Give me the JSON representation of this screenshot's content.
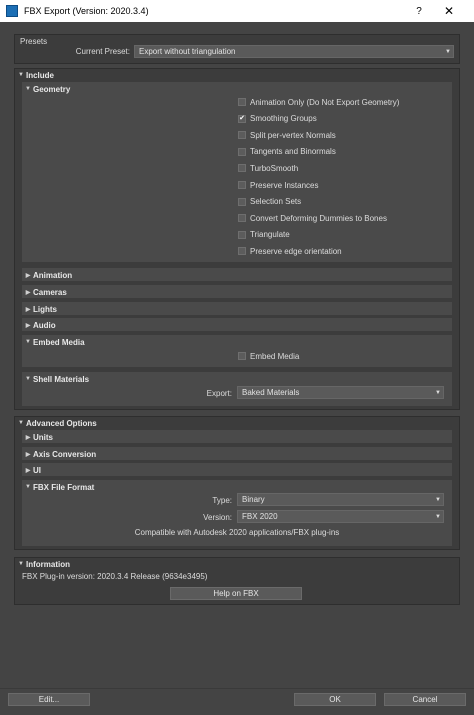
{
  "window": {
    "title": "FBX Export (Version: 2020.3.4)",
    "help": "?",
    "close": "✕"
  },
  "presets": {
    "section": "Presets",
    "current_label": "Current Preset:",
    "current_value": "Export without triangulation"
  },
  "include": {
    "title": "Include",
    "geometry": {
      "title": "Geometry",
      "options": [
        {
          "label": "Animation Only (Do Not Export Geometry)",
          "checked": false
        },
        {
          "label": "Smoothing Groups",
          "checked": true
        },
        {
          "label": "Split per-vertex Normals",
          "checked": false
        },
        {
          "label": "Tangents and Binormals",
          "checked": false
        },
        {
          "label": "TurboSmooth",
          "checked": false
        },
        {
          "label": "Preserve Instances",
          "checked": false
        },
        {
          "label": "Selection Sets",
          "checked": false
        },
        {
          "label": "Convert Deforming Dummies to Bones",
          "checked": false
        },
        {
          "label": "Triangulate",
          "checked": false
        },
        {
          "label": "Preserve edge orientation",
          "checked": false
        }
      ]
    },
    "collapsed": [
      "Animation",
      "Cameras",
      "Lights",
      "Audio"
    ],
    "embed_media": {
      "title": "Embed Media",
      "option": "Embed Media",
      "checked": false
    },
    "shell_materials": {
      "title": "Shell Materials",
      "export_label": "Export:",
      "export_value": "Baked Materials"
    }
  },
  "advanced": {
    "title": "Advanced Options",
    "collapsed": [
      "Units",
      "Axis Conversion",
      "UI"
    ],
    "fbx_file_format": {
      "title": "FBX File Format",
      "type_label": "Type:",
      "type_value": "Binary",
      "version_label": "Version:",
      "version_value": "FBX 2020",
      "compat": "Compatible with Autodesk 2020 applications/FBX plug-ins"
    }
  },
  "information": {
    "title": "Information",
    "text": "FBX Plug-in version: 2020.3.4 Release (9634e3495)",
    "help_button": "Help on FBX"
  },
  "footer": {
    "edit": "Edit...",
    "ok": "OK",
    "cancel": "Cancel"
  },
  "icons": {
    "expanded": "▼",
    "collapsed": "▶",
    "check": "✔",
    "dropdown": "▼"
  }
}
